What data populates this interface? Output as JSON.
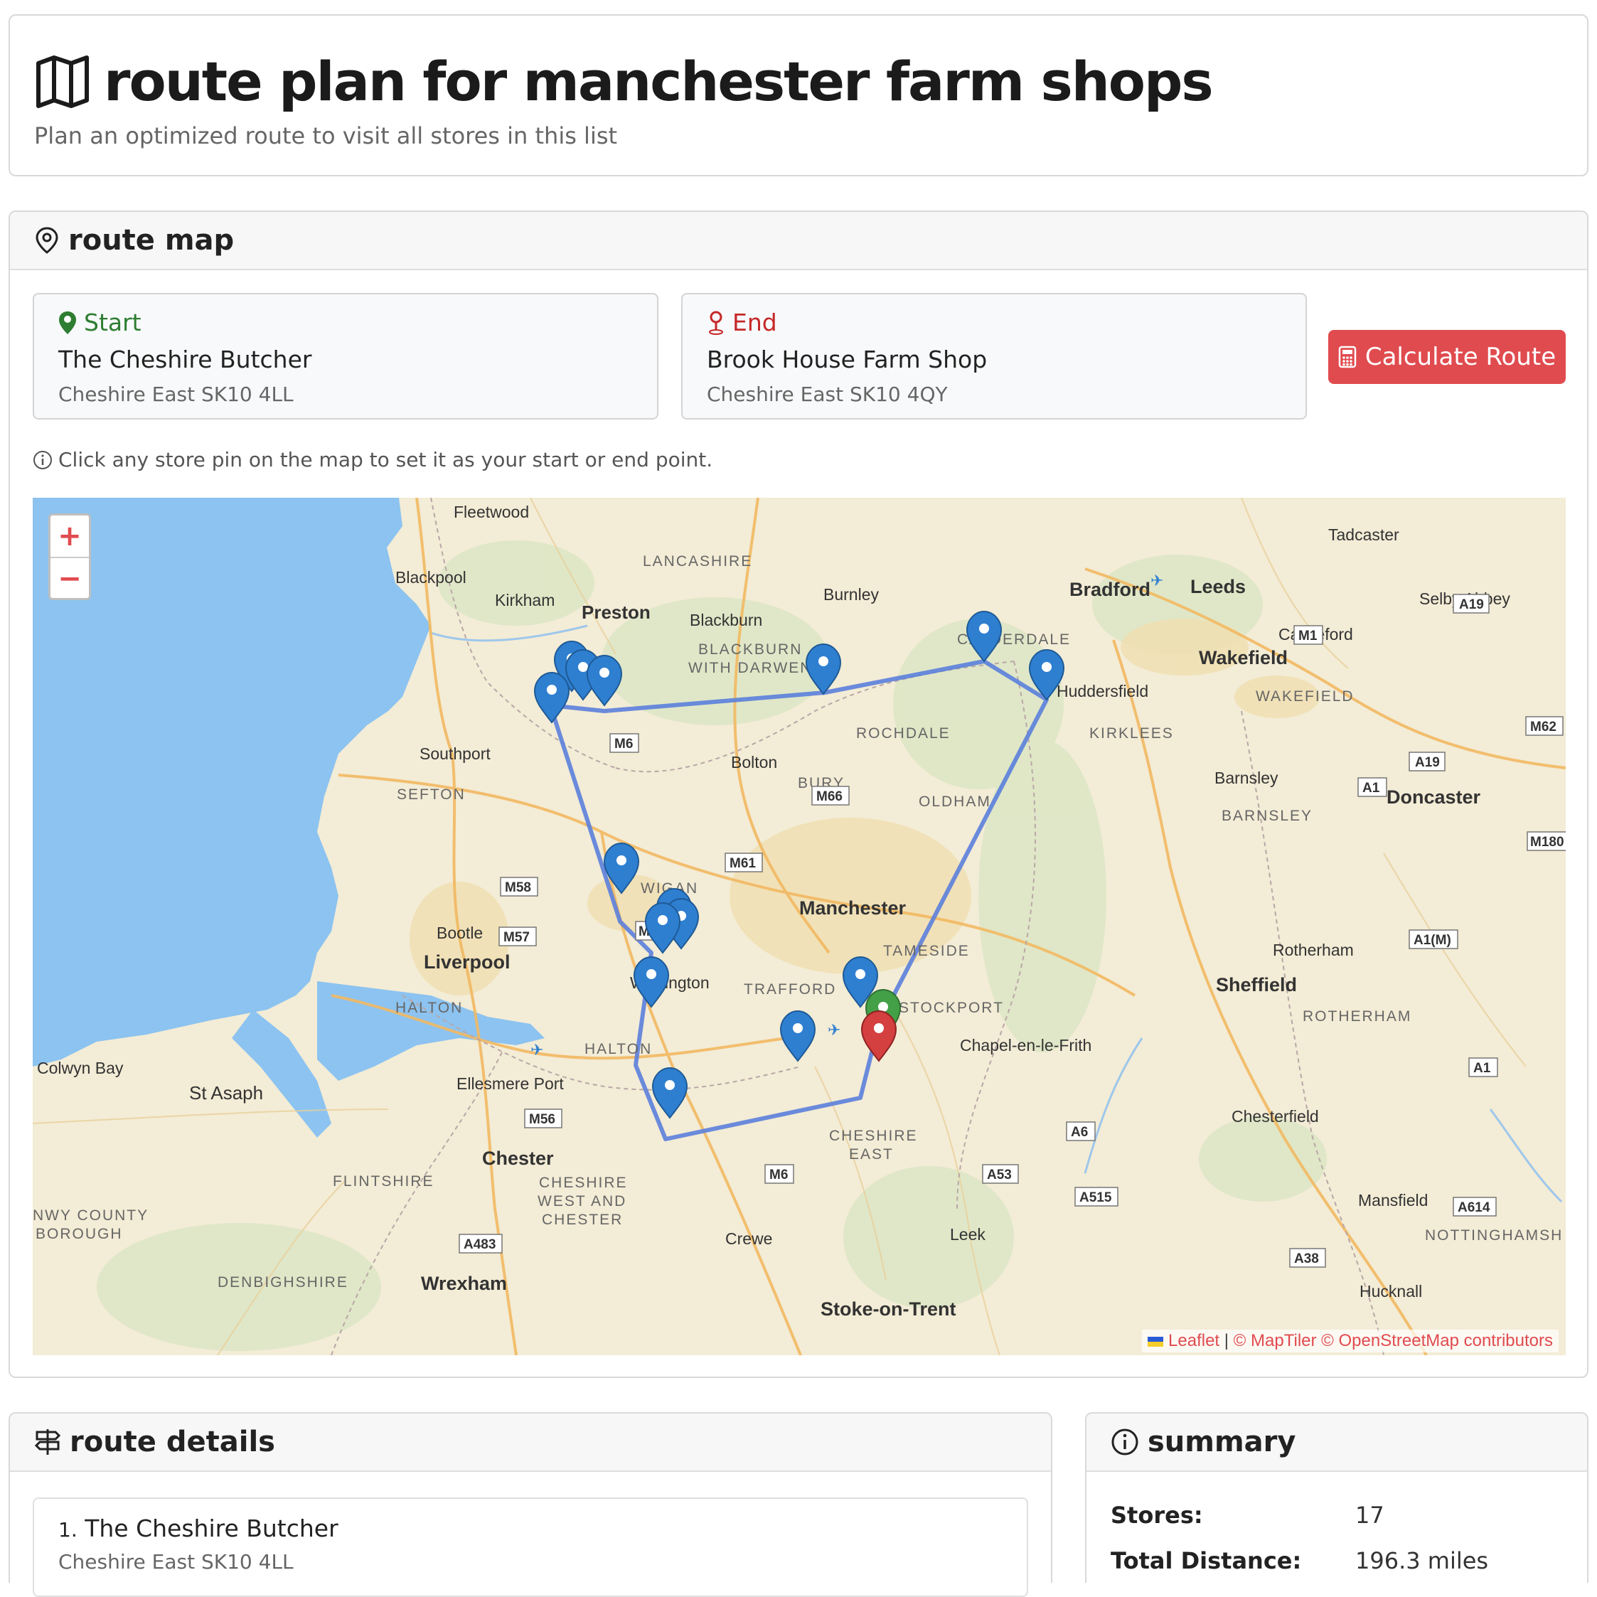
{
  "header": {
    "title": "route plan for manchester farm shops",
    "subtitle": "Plan an optimized route to visit all stores in this list"
  },
  "route_map": {
    "heading": "route map",
    "start": {
      "label": "Start",
      "name": "The Cheshire Butcher",
      "address": "Cheshire East SK10 4LL"
    },
    "end": {
      "label": "End",
      "name": "Brook House Farm Shop",
      "address": "Cheshire East SK10 4QY"
    },
    "calculate_label": "Calculate Route",
    "hint": "Click any store pin on the map to set it as your start or end point.",
    "zoom_in": "+",
    "zoom_out": "−",
    "attribution": {
      "leaflet": "Leaflet",
      "sep": "|",
      "tiles": "© MapTiler © OpenStreetMap contributors"
    },
    "places": {
      "fleetwood": "Fleetwood",
      "blackpool": "Blackpool",
      "kirkham": "Kirkham",
      "preston": "Preston",
      "lancashire": "LANCASHIRE",
      "burnley": "Burnley",
      "blackburn": "Blackburn",
      "blackburn_darwen_1": "BLACKBURN",
      "blackburn_darwen_2": "WITH DARWEN",
      "bradford": "Bradford",
      "leeds": "Leeds",
      "tadcaster": "Tadcaster",
      "selby": "Selby Abbey",
      "castleford": "Castleford",
      "wakefield": "Wakefield",
      "wakefield_c": "WAKEFIELD",
      "calderdale": "CALDERDALE",
      "huddersfield": "Huddersfield",
      "kirklees": "KIRKLEES",
      "southport": "Southport",
      "rochdale": "ROCHDALE",
      "bolton": "Bolton",
      "bury": "BURY",
      "oldham": "OLDHAM",
      "barnsley": "Barnsley",
      "barnsley_c": "BARNSLEY",
      "doncaster": "Doncaster",
      "sefton": "SEFTON",
      "wigan": "WIGAN",
      "manchester": "Manchester",
      "bootle": "Bootle",
      "liverpool": "Liverpool",
      "tameside": "TAMESIDE",
      "rotherham": "Rotherham",
      "sheffield": "Sheffield",
      "warrington": "Warrington",
      "trafford": "TRAFFORD",
      "stockport": "STOCKPORT",
      "halton_c": "HALTON",
      "halton": "HALTON",
      "rotherham_c": "ROTHERHAM",
      "chapel": "Chapel-en-le-Frith",
      "colwyn": "Colwyn Bay",
      "st_asaph": "St Asaph",
      "ellesmere": "Ellesmere Port",
      "chesterfield": "Chesterfield",
      "chester": "Chester",
      "cheshire_east_1": "CHESHIRE",
      "cheshire_east_2": "EAST",
      "flintshire": "FLINTSHIRE",
      "cwac_1": "CHESHIRE",
      "cwac_2": "WEST AND",
      "cwac_3": "CHESTER",
      "conwy_1": "NWY COUNTY",
      "conwy_2": "BOROUGH",
      "mansfield": "Mansfield",
      "crewe": "Crewe",
      "leek": "Leek",
      "nottingham": "NOTTINGHAMSH",
      "denbighshire": "DENBIGHSHIRE",
      "wrexham": "Wrexham",
      "hucknall": "Hucknall",
      "stoke": "Stoke-on-Trent"
    },
    "roads": {
      "a19a": "A19",
      "m1": "M1",
      "m62": "M62",
      "a19b": "A19",
      "a1a": "A1",
      "m180": "M180",
      "m6a": "M6",
      "m66": "M66",
      "m61": "M61",
      "m58": "M58",
      "m57": "M57",
      "m6b": "M6",
      "a1m": "A1(M)",
      "a1b": "A1",
      "a6": "A6",
      "m56": "M56",
      "m6c": "M6",
      "a53": "A53",
      "a515": "A515",
      "a614": "A614",
      "a483": "A483",
      "a38": "A38"
    },
    "colors": {
      "route": "#5b7fdc",
      "pin": "#2f7fd0",
      "start_pin": "#43a047",
      "end_pin": "#d43f3f",
      "sea": "#8cc3f0"
    }
  },
  "route_details": {
    "heading": "route details",
    "items": [
      {
        "index": "1.",
        "name": "The Cheshire Butcher",
        "address": "Cheshire East SK10 4LL"
      }
    ]
  },
  "summary": {
    "heading": "summary",
    "stores_label": "Stores:",
    "stores_value": "17",
    "distance_label": "Total Distance:",
    "distance_value": "196.3 miles"
  }
}
